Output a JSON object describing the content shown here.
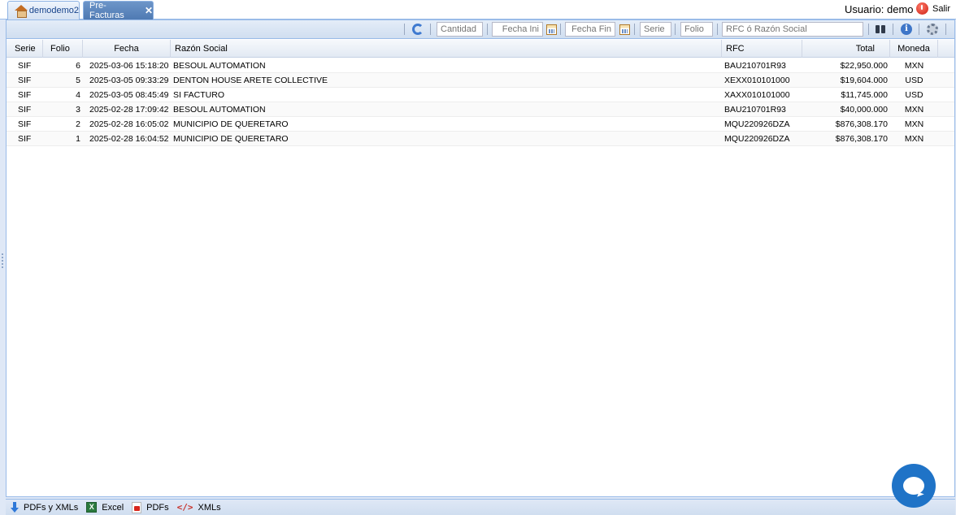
{
  "tabs": {
    "home_label": "demodemo2",
    "active_label": "Pre-Facturas",
    "close_glyph": "✕"
  },
  "user": {
    "label": "Usuario: demo",
    "logout_label": "Salir"
  },
  "toolbar": {
    "cantidad_placeholder": "Cantidad",
    "fecha_ini_placeholder": "Fecha Ini",
    "fecha_fin_placeholder": "Fecha Fin",
    "serie_placeholder": "Serie",
    "folio_placeholder": "Folio",
    "rfc_placeholder": "RFC ó Razón Social",
    "icons": [
      "refresh-icon",
      "calendar-icon",
      "binoculars-icon",
      "info-icon",
      "gear-icon"
    ]
  },
  "grid": {
    "columns": [
      "Serie",
      "Folio",
      "Fecha",
      "Razón Social",
      "RFC",
      "Total",
      "Moneda"
    ],
    "rows": [
      {
        "serie": "SIF",
        "folio": "6",
        "fecha": "2025-03-06 15:18:20",
        "razon": "BESOUL AUTOMATION",
        "rfc": "BAU210701R93",
        "total": "$22,950.000",
        "moneda": "MXN"
      },
      {
        "serie": "SIF",
        "folio": "5",
        "fecha": "2025-03-05 09:33:29",
        "razon": "DENTON HOUSE ARETE COLLECTIVE",
        "rfc": "XEXX010101000",
        "total": "$19,604.000",
        "moneda": "USD"
      },
      {
        "serie": "SIF",
        "folio": "4",
        "fecha": "2025-03-05 08:45:49",
        "razon": "SI FACTURO",
        "rfc": "XAXX010101000",
        "total": "$11,745.000",
        "moneda": "USD"
      },
      {
        "serie": "SIF",
        "folio": "3",
        "fecha": "2025-02-28 17:09:42",
        "razon": "BESOUL AUTOMATION",
        "rfc": "BAU210701R93",
        "total": "$40,000.000",
        "moneda": "MXN"
      },
      {
        "serie": "SIF",
        "folio": "2",
        "fecha": "2025-02-28 16:05:02",
        "razon": "MUNICIPIO DE QUERETARO",
        "rfc": "MQU220926DZA",
        "total": "$876,308.170",
        "moneda": "MXN"
      },
      {
        "serie": "SIF",
        "folio": "1",
        "fecha": "2025-02-28 16:04:52",
        "razon": "MUNICIPIO DE QUERETARO",
        "rfc": "MQU220926DZA",
        "total": "$876,308.170",
        "moneda": "MXN"
      }
    ]
  },
  "bottombar": {
    "pdfs_xmls": "PDFs y XMLs",
    "excel": "Excel",
    "pdfs": "PDFs",
    "xmls": "XMLs",
    "excel_glyph": "X",
    "xml_glyph": "</>"
  },
  "colors": {
    "accent": "#4f7ab3",
    "chat": "#1f73c7"
  }
}
